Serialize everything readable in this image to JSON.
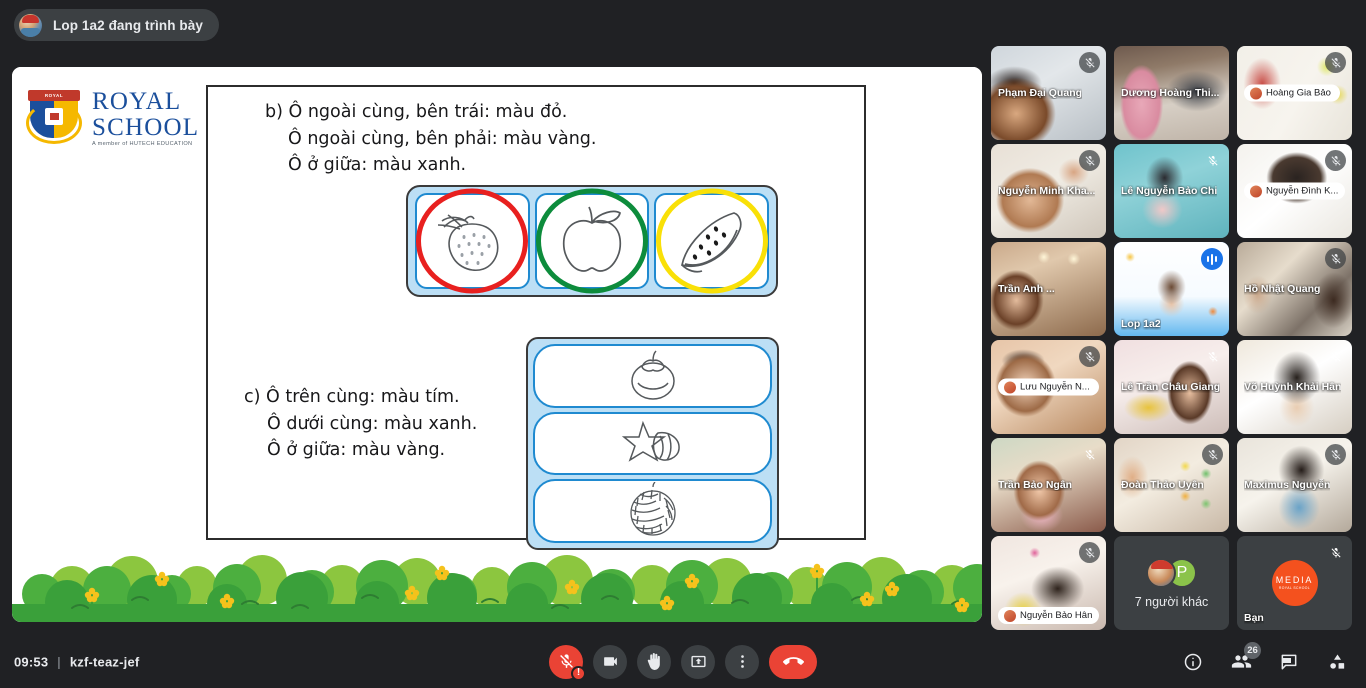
{
  "topbar": {
    "presenting_text": "Lop 1a2 đang trình bày",
    "avatar_name": "presenter-avatar"
  },
  "slide": {
    "logo": {
      "banner": "ROYAL",
      "line1": "ROYAL",
      "line2": "SCHOOL",
      "tagline": "A member of HUTECH EDUCATION"
    },
    "question_b": {
      "line1": "b) Ô ngoài cùng, bên trái: màu đỏ.",
      "line2": "Ô ngoài cùng, bên phải: màu vàng.",
      "line3": "Ô ở giữa: màu xanh."
    },
    "question_c": {
      "line1": "c) Ô trên cùng: màu tím.",
      "line2": "Ô dưới cùng: màu xanh.",
      "line3": "Ô ở giữa: màu vàng."
    },
    "tray_h_cells": [
      {
        "fruit": "strawberry",
        "ring_color": "#e8201f",
        "ring_name": "red"
      },
      {
        "fruit": "apple",
        "ring_color": "#0d8c3c",
        "ring_name": "green"
      },
      {
        "fruit": "watermelon",
        "ring_color": "#f9e007",
        "ring_name": "yellow"
      }
    ],
    "tray_v_cells": [
      {
        "fruit": "mangosteen"
      },
      {
        "fruit": "starfruit"
      },
      {
        "fruit": "custard-apple"
      }
    ]
  },
  "participants": [
    {
      "name": "Phạm Đại Quang",
      "label_style": "mid",
      "muted": true,
      "mic_style": "circle",
      "active": false
    },
    {
      "name": "Dương Hoàng Thi...",
      "label_style": "mid",
      "muted": false,
      "mic_style": "none",
      "active": false
    },
    {
      "name": "Hoàng Gia Bảo",
      "label_style": "pill",
      "muted": true,
      "mic_style": "circle",
      "active": false
    },
    {
      "name": "Nguyễn Minh Kha...",
      "label_style": "mid",
      "muted": true,
      "mic_style": "circle",
      "active": false
    },
    {
      "name": "Lê Nguyễn Bảo Chi",
      "label_style": "mid",
      "muted": true,
      "mic_style": "plain",
      "active": false
    },
    {
      "name": "Nguyễn Đình K...",
      "label_style": "pill",
      "muted": true,
      "mic_style": "circle",
      "active": false
    },
    {
      "name": "Trần Anh ...",
      "label_style": "mid",
      "muted": false,
      "mic_style": "none",
      "active": false
    },
    {
      "name": "Lop 1a2",
      "label_style": "bot",
      "muted": false,
      "mic_style": "speaking",
      "active": true
    },
    {
      "name": "Hồ Nhật Quang",
      "label_style": "mid",
      "muted": true,
      "mic_style": "circle",
      "active": false
    },
    {
      "name": "Lưu Nguyễn N...",
      "label_style": "pill",
      "muted": true,
      "mic_style": "circle",
      "active": false
    },
    {
      "name": "Lê Trần Châu Giang",
      "label_style": "mid",
      "muted": true,
      "mic_style": "plain",
      "active": false
    },
    {
      "name": "Võ Huỳnh Khải Hân",
      "label_style": "mid",
      "muted": true,
      "mic_style": "plain",
      "active": false
    },
    {
      "name": "Trần Bảo Ngân",
      "label_style": "mid",
      "muted": true,
      "mic_style": "plain",
      "active": false
    },
    {
      "name": "Đoàn Thảo Uyên",
      "label_style": "mid",
      "muted": true,
      "mic_style": "circle",
      "active": false
    },
    {
      "name": "Maximus Nguyễn",
      "label_style": "mid",
      "muted": true,
      "mic_style": "circle",
      "active": false
    },
    {
      "name": "Nguyễn Bảo Hân",
      "label_style": "pill",
      "muted": true,
      "mic_style": "circle",
      "active": false
    }
  ],
  "others_tile": {
    "label": "7 người khác",
    "avatar_initial": "P"
  },
  "self_tile": {
    "label": "Bạn",
    "logo_line1": "MEDIA",
    "logo_line2": "ROYAL SCHOOL",
    "muted": true
  },
  "bottombar": {
    "time": "09:53",
    "separator": "|",
    "meeting_code": "kzf-teaz-jef",
    "controls": [
      {
        "name": "microphone-button",
        "icon": "mic-off-icon",
        "state": "muted",
        "warning": "!"
      },
      {
        "name": "camera-button",
        "icon": "camera-icon",
        "state": "on"
      },
      {
        "name": "raise-hand-button",
        "icon": "hand-icon",
        "state": "off"
      },
      {
        "name": "present-screen-button",
        "icon": "present-icon",
        "state": "off"
      },
      {
        "name": "more-options-button",
        "icon": "more-vertical-icon",
        "state": "off"
      },
      {
        "name": "end-call-button",
        "icon": "hangup-icon",
        "state": "danger"
      }
    ],
    "right_icons": [
      {
        "name": "meeting-details-button",
        "icon": "info-icon",
        "badge": ""
      },
      {
        "name": "participants-button",
        "icon": "people-icon",
        "badge": "26"
      },
      {
        "name": "chat-button",
        "icon": "chat-icon",
        "badge": ""
      },
      {
        "name": "activities-button",
        "icon": "activities-icon",
        "badge": ""
      }
    ]
  },
  "colors": {
    "app_bg": "#202124",
    "surface": "#3c4043",
    "accent": "#1a73e8",
    "danger": "#ea4335",
    "tray_blue": "#bcdff5",
    "cell_border": "#1f8ad0",
    "logo_blue": "#1b4f9c",
    "logo_gold": "#f5b800",
    "media_orange": "#f4511e"
  }
}
